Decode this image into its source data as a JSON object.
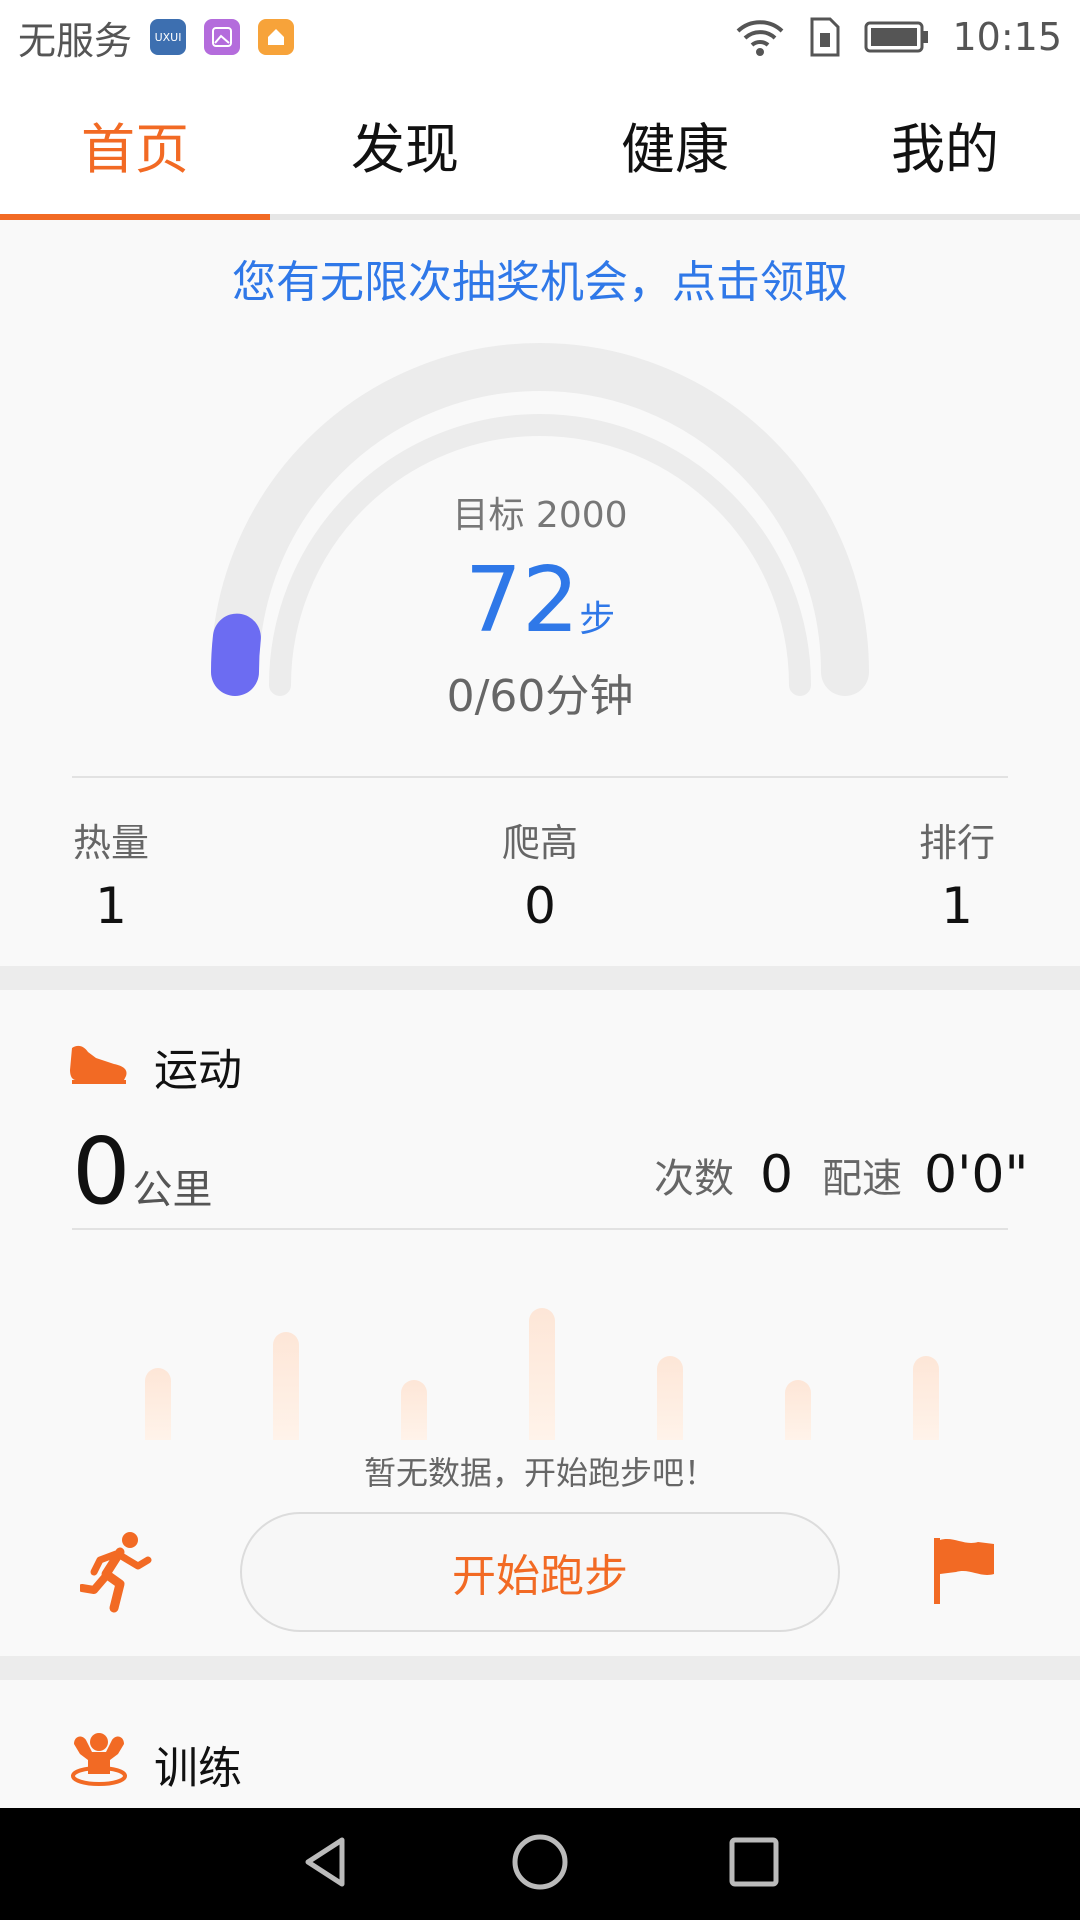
{
  "status_bar": {
    "carrier": "无服务",
    "time": "10:15",
    "app_icons": [
      "uxui-app-icon",
      "gallery-app-icon",
      "home-app-icon"
    ],
    "icons": [
      "wifi-icon",
      "sim-icon",
      "battery-icon"
    ]
  },
  "tabs": [
    {
      "label": "首页",
      "active": true
    },
    {
      "label": "发现",
      "active": false
    },
    {
      "label": "健康",
      "active": false
    },
    {
      "label": "我的",
      "active": false
    }
  ],
  "promo": "您有无限次抽奖机会，点击领取",
  "gauge": {
    "target": "目标 2000",
    "steps": "72",
    "steps_unit": "步",
    "minutes": "0/60分钟",
    "progress_fraction": 0.036
  },
  "stats": [
    {
      "label": "热量",
      "value": "1"
    },
    {
      "label": "爬高",
      "value": "0"
    },
    {
      "label": "排行",
      "value": "1"
    }
  ],
  "sport": {
    "title": "运动",
    "distance": "0",
    "distance_unit": "公里",
    "count_label": "次数",
    "count_value": "0",
    "pace_label": "配速",
    "pace_value": "0'0\"",
    "no_data": "暂无数据，开始跑步吧！",
    "start_button": "开始跑步"
  },
  "training": {
    "title": "训练"
  },
  "colors": {
    "accent": "#f26a24",
    "blue": "#2f78e8",
    "gauge_progress": "#6c6cf2",
    "gauge_track": "#ececec"
  }
}
